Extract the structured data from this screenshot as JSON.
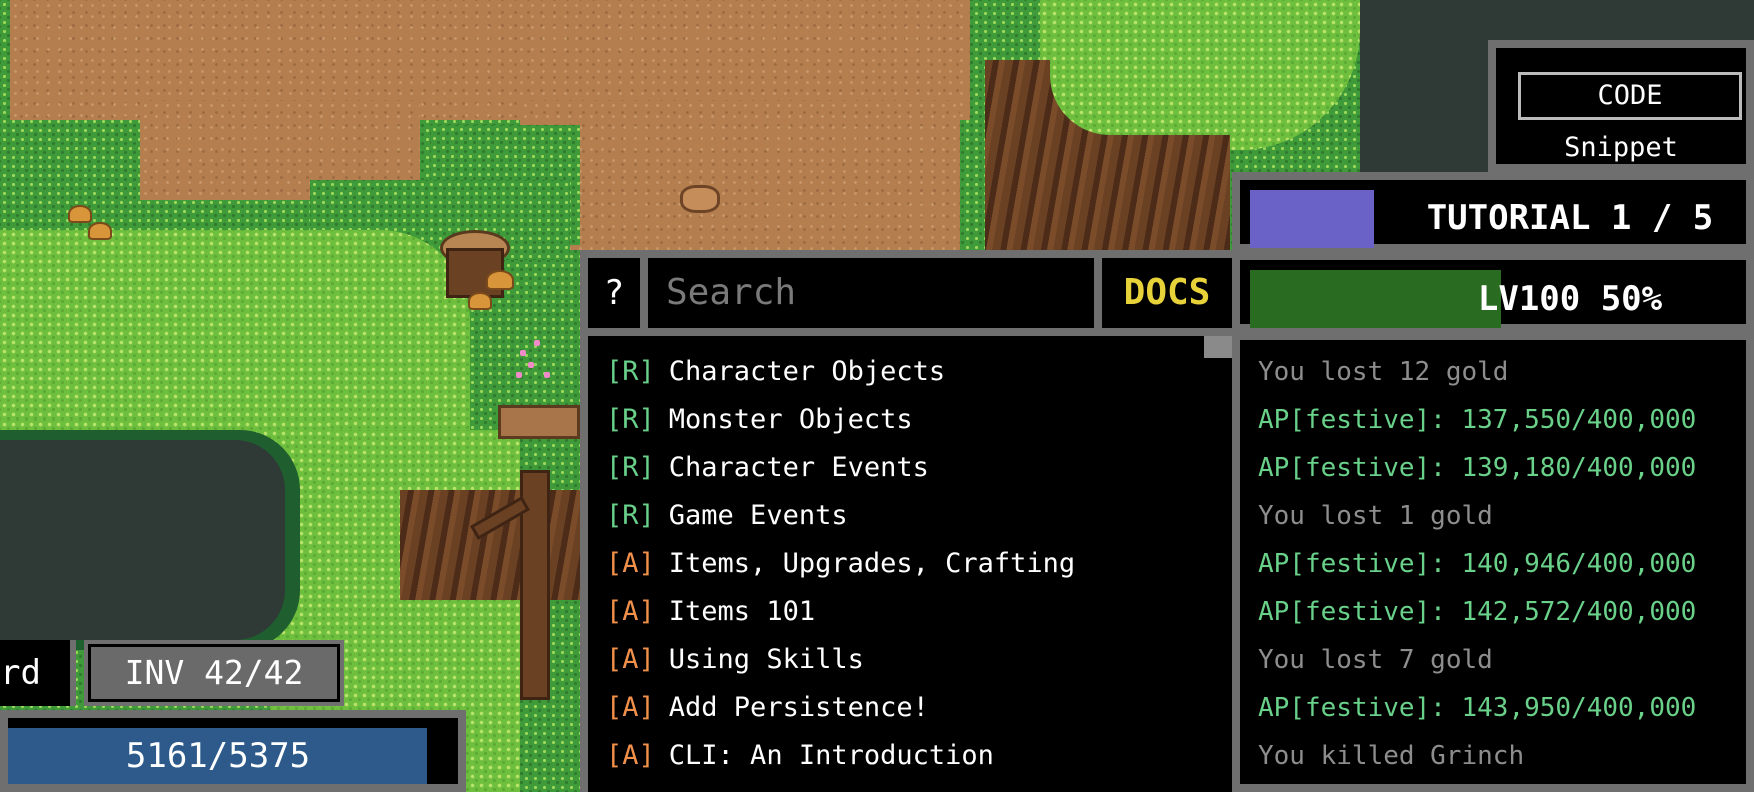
{
  "code_panel": {
    "button_label": "CODE",
    "subtitle": "Snippet"
  },
  "tutorial": {
    "label": "TUTORIAL 1 / 5",
    "swatch_color": "#6a62c6"
  },
  "level": {
    "label": "LV100 50%",
    "progress": 0.5,
    "bar_color": "#2a6b22"
  },
  "log": [
    {
      "text": "You lost 12 gold",
      "kind": "lost"
    },
    {
      "text": "AP[festive]: 137,550/400,000",
      "kind": "ap"
    },
    {
      "text": "AP[festive]: 139,180/400,000",
      "kind": "ap"
    },
    {
      "text": "You lost 1 gold",
      "kind": "lost"
    },
    {
      "text": "AP[festive]: 140,946/400,000",
      "kind": "ap"
    },
    {
      "text": "AP[festive]: 142,572/400,000",
      "kind": "ap"
    },
    {
      "text": "You lost 7 gold",
      "kind": "lost"
    },
    {
      "text": "AP[festive]: 143,950/400,000",
      "kind": "ap"
    },
    {
      "text": "You killed Grinch",
      "kind": "lost"
    }
  ],
  "docs": {
    "help_label": "?",
    "search_placeholder": "Search",
    "docs_label": "DOCS",
    "items": [
      {
        "tag": "[R]",
        "type": "R",
        "label": "Character Objects"
      },
      {
        "tag": "[R]",
        "type": "R",
        "label": "Monster Objects"
      },
      {
        "tag": "[R]",
        "type": "R",
        "label": "Character Events"
      },
      {
        "tag": "[R]",
        "type": "R",
        "label": "Game Events"
      },
      {
        "tag": "[A]",
        "type": "A",
        "label": "Items, Upgrades, Crafting"
      },
      {
        "tag": "[A]",
        "type": "A",
        "label": "Items 101"
      },
      {
        "tag": "[A]",
        "type": "A",
        "label": "Using Skills"
      },
      {
        "tag": "[A]",
        "type": "A",
        "label": "Add Persistence!"
      },
      {
        "tag": "[A]",
        "type": "A",
        "label": "CLI: An Introduction"
      }
    ]
  },
  "hud": {
    "left_label_fragment": "rd",
    "inventory_label": "INV 42/42",
    "hp_label": "5161/5375",
    "hp_current": 5161,
    "hp_max": 5375,
    "hp_color": "#2d5a8a"
  },
  "colors": {
    "ap_text": "#69d189",
    "lost_text": "#8d8d8d",
    "docs_text": "#e8d23a",
    "tag_R": "#69d189",
    "tag_A": "#f0904a"
  }
}
